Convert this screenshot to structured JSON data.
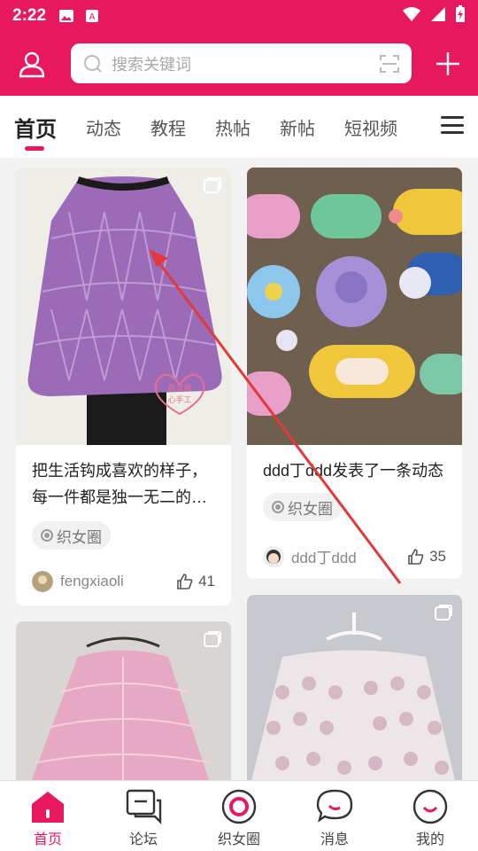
{
  "status_bar": {
    "time": "2:22"
  },
  "search": {
    "placeholder": "搜索关键词"
  },
  "tabs": [
    {
      "label": "首页",
      "active": true
    },
    {
      "label": "动态"
    },
    {
      "label": "教程"
    },
    {
      "label": "热帖"
    },
    {
      "label": "新帖"
    },
    {
      "label": "短视频"
    }
  ],
  "posts": [
    {
      "title": "把生活钩成喜欢的样子，每一件都是独一无二的…",
      "tag": "织女圈",
      "user": "fengxiaoli",
      "likes": "41",
      "watermark": "森蓝雅 心手工"
    },
    {
      "title": "ddd丁ddd发表了一条动态",
      "tag": "织女圈",
      "user": "ddd丁ddd",
      "likes": "35"
    }
  ],
  "bottom_nav": [
    {
      "label": "首页",
      "icon": "home-icon",
      "active": true
    },
    {
      "label": "论坛",
      "icon": "forum-icon"
    },
    {
      "label": "织女圈",
      "icon": "circle-icon"
    },
    {
      "label": "消息",
      "icon": "message-icon"
    },
    {
      "label": "我的",
      "icon": "profile-icon"
    }
  ],
  "colors": {
    "brand": "#e8185f",
    "like": "#555555",
    "tag_bg": "#f1f1f1"
  }
}
